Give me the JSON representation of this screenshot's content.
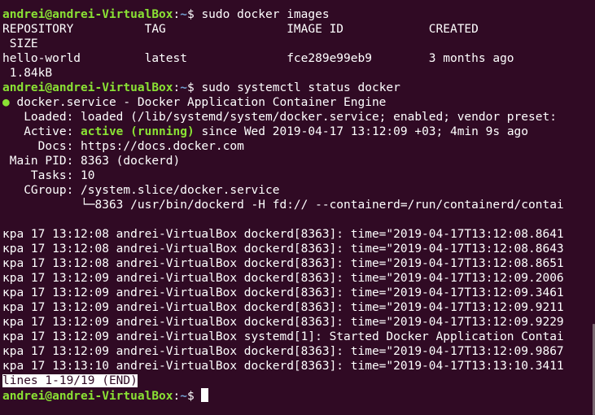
{
  "prompt": {
    "user_host": "andrei@andrei-VirtualBox",
    "separator": ":",
    "path": "~",
    "symbol": "$ "
  },
  "commands": {
    "docker_images": "sudo docker images",
    "systemctl": "sudo systemctl status docker"
  },
  "images_table": {
    "header": "REPOSITORY          TAG                 IMAGE ID            CREATED",
    "header_wrap": " SIZE",
    "row": "hello-world         latest              fce289e99eb9        3 months ago",
    "row_wrap": " 1.84kB"
  },
  "status": {
    "dot": "●",
    "service_line": " docker.service - Docker Application Container Engine",
    "loaded": "   Loaded: loaded (/lib/systemd/system/docker.service; enabled; vendor preset:",
    "active_label": "   Active: ",
    "active_value": "active (running)",
    "active_since": " since Wed 2019-04-17 13:12:09 +03; 4min 9s ago",
    "docs": "     Docs: https://docs.docker.com",
    "main_pid": " Main PID: 8363 (dockerd)",
    "tasks": "    Tasks: 10",
    "cgroup": "   CGroup: /system.slice/docker.service",
    "cgroup_child": "           └─8363 /usr/bin/dockerd -H fd:// --containerd=/run/containerd/contai"
  },
  "log_lines": [
    "кра 17 13:12:08 andrei-VirtualBox dockerd[8363]: time=\"2019-04-17T13:12:08.8641",
    "кра 17 13:12:08 andrei-VirtualBox dockerd[8363]: time=\"2019-04-17T13:12:08.8643",
    "кра 17 13:12:08 andrei-VirtualBox dockerd[8363]: time=\"2019-04-17T13:12:08.8651",
    "кра 17 13:12:09 andrei-VirtualBox dockerd[8363]: time=\"2019-04-17T13:12:09.2006",
    "кра 17 13:12:09 andrei-VirtualBox dockerd[8363]: time=\"2019-04-17T13:12:09.3461",
    "кра 17 13:12:09 andrei-VirtualBox dockerd[8363]: time=\"2019-04-17T13:12:09.9211",
    "кра 17 13:12:09 andrei-VirtualBox dockerd[8363]: time=\"2019-04-17T13:12:09.9229",
    "кра 17 13:12:09 andrei-VirtualBox systemd[1]: Started Docker Application Contai",
    "кра 17 13:12:09 andrei-VirtualBox dockerd[8363]: time=\"2019-04-17T13:12:09.9867",
    "кра 17 13:13:10 andrei-VirtualBox dockerd[8363]: time=\"2019-04-17T13:13:10.3411"
  ],
  "pager_status": "lines 1-19/19 (END)",
  "colors": {
    "background": "#300a24",
    "prompt_user": "#8ae234",
    "prompt_path": "#729fcf",
    "text": "#ffffff"
  }
}
